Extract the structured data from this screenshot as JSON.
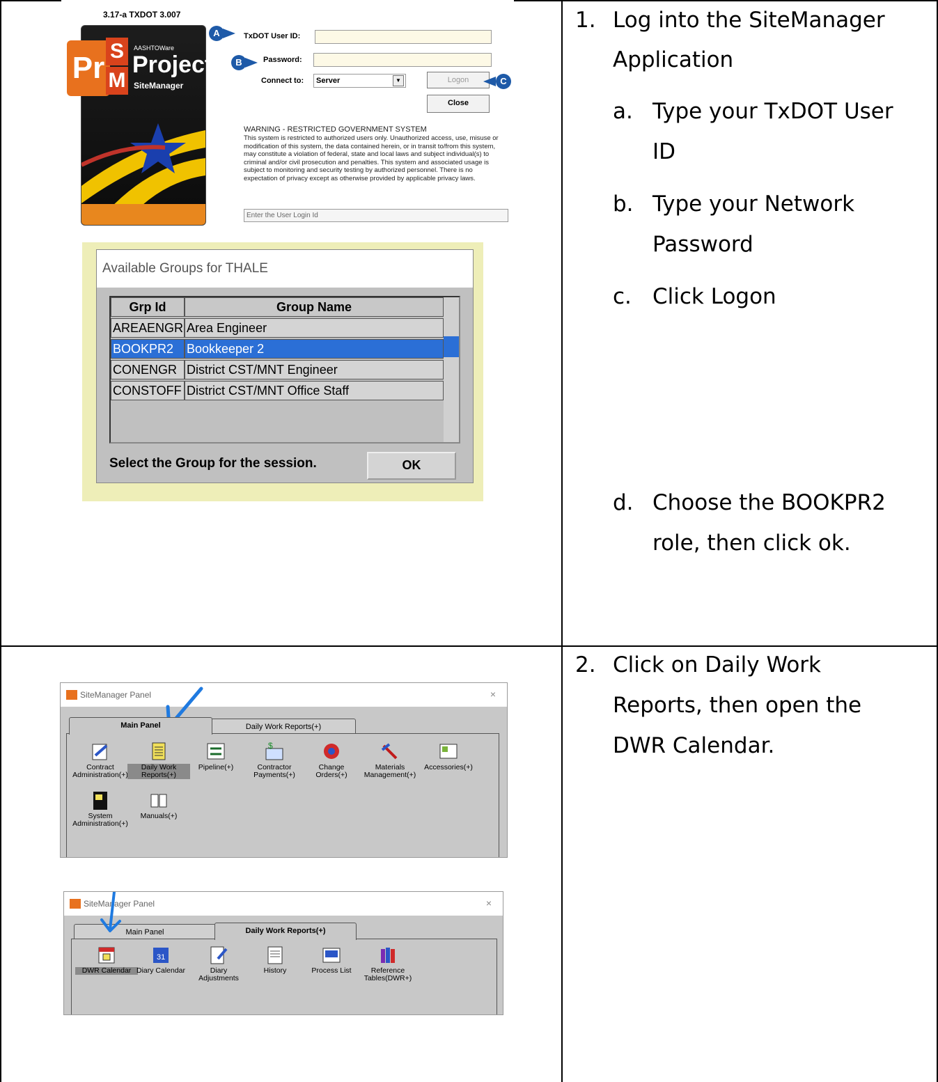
{
  "step1": {
    "number": "1.",
    "text_line1": "Log into the SiteManager",
    "text_line2": "Application",
    "a_letter": "a.",
    "a_line1": "Type your TxDOT User",
    "a_line2": "ID",
    "b_letter": "b.",
    "b_line1": "Type your Network",
    "b_line2": "Password",
    "c_letter": "c.",
    "c_line1": "Click Logon",
    "d_letter": "d.",
    "d_line1": "Choose the BOOKPR2",
    "d_line2": "role, then click ok."
  },
  "step2": {
    "number": "2.",
    "line1": "Click on Daily Work",
    "line2": "Reports, then open the",
    "line3": "DWR Calendar."
  },
  "login": {
    "version": "3.17-a TXDOT 3.007",
    "logo_aashto": "AASHTOWare",
    "logo_project": "Project",
    "logo_sitemanager": "SiteManager",
    "logo_pr": "Pr",
    "logo_s": "S",
    "logo_m": "M",
    "user_id_label": "TxDOT User ID:",
    "password_label": "Password:",
    "connect_label": "Connect to:",
    "connect_value": "Server",
    "logon_button": "Logon",
    "close_button": "Close",
    "callout_a": "A",
    "callout_b": "B",
    "callout_c": "C",
    "warning_title": "WARNING - RESTRICTED GOVERNMENT SYSTEM",
    "warning_text": "This system is restricted to authorized users only. Unauthorized access, use, misuse or modification of this system, the data contained herein, or in transit to/from this system, may constitute a violation of federal, state and local laws and subject individual(s) to criminal and/or civil prosecution and penalties. This system and associated usage is subject to monitoring and security testing by authorized personnel. There is no expectation of privacy except as otherwise provided by applicable privacy laws.",
    "status_text": "Enter the User Login Id"
  },
  "groups": {
    "title": "Available Groups for THALE",
    "col_id": "Grp Id",
    "col_name": "Group Name",
    "rows": [
      {
        "id": "AREAENGR",
        "name": "Area Engineer"
      },
      {
        "id": "BOOKPR2",
        "name": "Bookkeeper 2"
      },
      {
        "id": "CONENGR",
        "name": "District CST/MNT Engineer"
      },
      {
        "id": "CONSTOFF",
        "name": "District CST/MNT Office Staff"
      }
    ],
    "selected_index": 1,
    "prompt": "Select the Group for the session.",
    "ok_button": "OK"
  },
  "panel1": {
    "title": "SiteManager Panel",
    "close": "×",
    "tab_main": "Main Panel",
    "tab_dwr": "Daily Work Reports(+)",
    "tiles": [
      {
        "l1": "Contract",
        "l2": "Administration(+)",
        "icon": "contract-icon"
      },
      {
        "l1": "Daily Work",
        "l2": "Reports(+)",
        "icon": "daily-work-reports-icon"
      },
      {
        "l1": "Pipeline(+)",
        "l2": "",
        "icon": "pipeline-icon"
      },
      {
        "l1": "Contractor",
        "l2": "Payments(+)",
        "icon": "contractor-payments-icon"
      },
      {
        "l1": "Change",
        "l2": "Orders(+)",
        "icon": "change-orders-icon"
      },
      {
        "l1": "Materials",
        "l2": "Management(+)",
        "icon": "materials-icon"
      },
      {
        "l1": "Accessories(+)",
        "l2": "",
        "icon": "accessories-icon"
      },
      {
        "l1": "System",
        "l2": "Administration(+)",
        "icon": "system-admin-icon"
      },
      {
        "l1": "Manuals(+)",
        "l2": "",
        "icon": "manuals-icon"
      }
    ]
  },
  "panel2": {
    "title": "SiteManager Panel",
    "close": "×",
    "tab_main": "Main Panel",
    "tab_dwr": "Daily Work Reports(+)",
    "tiles": [
      {
        "l1": "DWR Calendar",
        "l2": "",
        "icon": "dwr-calendar-icon"
      },
      {
        "l1": "Diary Calendar",
        "l2": "",
        "icon": "diary-calendar-icon"
      },
      {
        "l1": "Diary",
        "l2": "Adjustments",
        "icon": "diary-adjustments-icon"
      },
      {
        "l1": "History",
        "l2": "",
        "icon": "history-icon"
      },
      {
        "l1": "Process List",
        "l2": "",
        "icon": "process-list-icon"
      },
      {
        "l1": "Reference",
        "l2": "Tables(DWR+)",
        "icon": "reference-tables-icon"
      }
    ]
  },
  "colors": {
    "callout": "#1e5aa8",
    "selection": "#2b6fd6",
    "arrow": "#1f7ae0",
    "logo_orange": "#e8711e"
  }
}
